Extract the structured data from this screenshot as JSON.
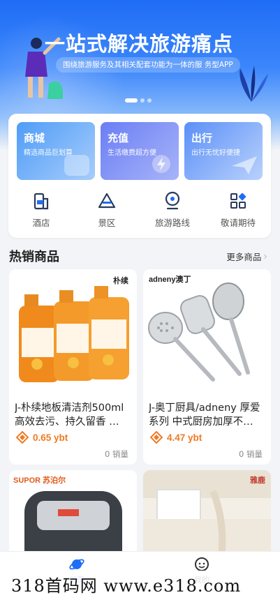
{
  "banner": {
    "title": "一站式解决旅游痛点",
    "subtitle": "围绕旅游服务及其相关配套功能为一体的服 务型APP",
    "slide_index": 1,
    "slide_count": 3
  },
  "services": [
    {
      "title": "商城",
      "subtitle": "精选商品巨划算",
      "icon": "shop-bag-icon"
    },
    {
      "title": "充值",
      "subtitle": "生活缴费超方便",
      "icon": "lightning-icon"
    },
    {
      "title": "出行",
      "subtitle": "出行无忧好便捷",
      "icon": "paper-plane-icon"
    }
  ],
  "shortcuts": [
    {
      "label": "酒店",
      "icon": "hotel-icon"
    },
    {
      "label": "景区",
      "icon": "scenic-icon"
    },
    {
      "label": "旅游路线",
      "icon": "location-pin-icon"
    },
    {
      "label": "敬请期待",
      "icon": "grid-apps-icon"
    }
  ],
  "hot": {
    "title": "热销商品",
    "more": "更多商品"
  },
  "products": [
    {
      "name": "J-朴续地板清洁剂500ml高效去污、持久留香 …",
      "price": "0.65 ybt",
      "sales": "0 销量",
      "brand": "朴续"
    },
    {
      "name": "J-奥丁厨具/adneny 厚爱系列 中式厨房加厚不…",
      "price": "4.47 ybt",
      "sales": "0 销量",
      "brand": "adneny澳丁"
    },
    {
      "name": "",
      "price": "",
      "sales": "",
      "brand": "SUPOR 苏泊尔"
    },
    {
      "name": "",
      "price": "",
      "sales": "",
      "brand": "雅鹿"
    }
  ],
  "tabbar": [
    {
      "label": "首页",
      "icon": "home-planet-icon",
      "active": true
    },
    {
      "label": "我的",
      "icon": "profile-face-icon",
      "active": false
    }
  ],
  "watermark": "318首码网  www.e318.com",
  "colors": {
    "primary": "#1f6df6",
    "price": "#f07a22",
    "background": "#f2f4f7"
  }
}
